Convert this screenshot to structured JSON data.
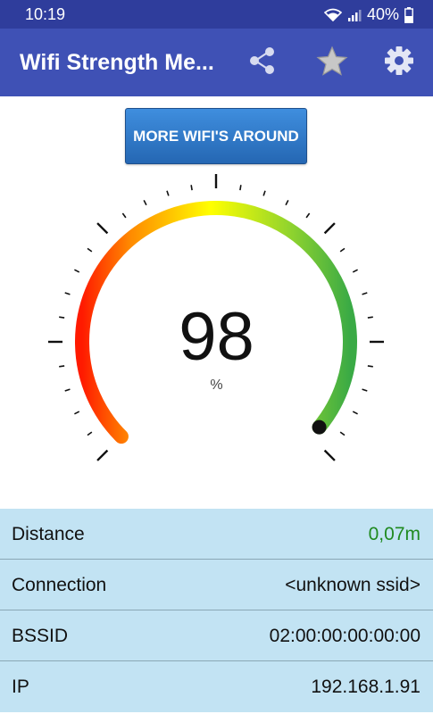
{
  "status_bar": {
    "time": "10:19",
    "battery": "40%",
    "icons": [
      "wifi-icon",
      "signal-icon",
      "battery-icon"
    ]
  },
  "app_bar": {
    "title": "Wifi Strength Me...",
    "actions": [
      "share-icon",
      "star-icon",
      "settings-icon"
    ]
  },
  "more_wifi_button": {
    "label": "MORE WIFI'S AROUND"
  },
  "gauge": {
    "value": 98,
    "display": "98",
    "unit": "%",
    "colors": [
      "#ff1a00",
      "#ff8a00",
      "#ffff00",
      "#8fd32e",
      "#3aaa45"
    ]
  },
  "info": {
    "rows": [
      {
        "label": "Distance",
        "value": "0,07m",
        "value_color": "#1f8a1f"
      },
      {
        "label": "Connection",
        "value": "<unknown ssid>"
      },
      {
        "label": "BSSID",
        "value": "02:00:00:00:00:00"
      },
      {
        "label": "IP",
        "value": "192.168.1.91"
      }
    ]
  },
  "colors": {
    "status_bar": "#2f3d9c",
    "app_bar": "#3f51b5",
    "info_background": "#c2e3f3"
  }
}
